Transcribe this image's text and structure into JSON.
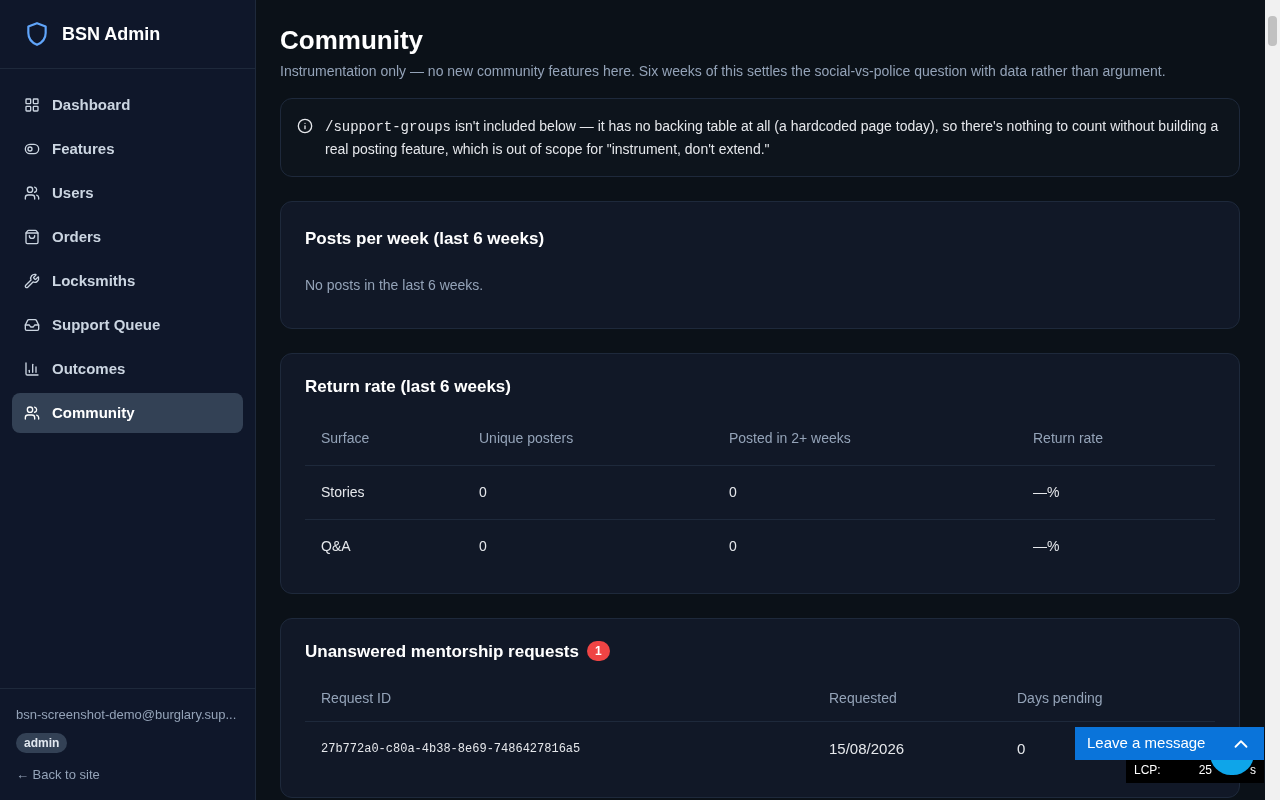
{
  "sidebar": {
    "brand": "BSN Admin",
    "items": [
      {
        "label": "Dashboard",
        "selected": false
      },
      {
        "label": "Features",
        "selected": false
      },
      {
        "label": "Users",
        "selected": false
      },
      {
        "label": "Orders",
        "selected": false
      },
      {
        "label": "Locksmiths",
        "selected": false
      },
      {
        "label": "Support Queue",
        "selected": false
      },
      {
        "label": "Outcomes",
        "selected": false
      },
      {
        "label": "Community",
        "selected": true
      }
    ],
    "email": "bsn-screenshot-demo@burglary.sup...",
    "role": "admin",
    "back_link": "← Back to site"
  },
  "page": {
    "title": "Community",
    "subtitle": "Instrumentation only — no new community features here. Six weeks of this settles the social-vs-police question with data rather than argument.",
    "notice": {
      "code": "/support-groups",
      "text": "isn't included below — it has no backing table at all (a hardcoded page today), so there's nothing to count without building a real posting feature, which is out of scope for \"instrument, don't extend.\""
    },
    "posts_card": {
      "title": "Posts per week (last 6 weeks)",
      "empty": "No posts in the last 6 weeks."
    },
    "return_card": {
      "title": "Return rate (last 6 weeks)",
      "columns": [
        "Surface",
        "Unique posters",
        "Posted in 2+ weeks",
        "Return rate"
      ],
      "rows": [
        [
          "Stories",
          "0",
          "0",
          "—%"
        ],
        [
          "Q&A",
          "0",
          "0",
          "—%"
        ]
      ]
    },
    "mentorship_card": {
      "title": "Unanswered mentorship requests",
      "badge": "1",
      "columns": [
        "Request ID",
        "Requested",
        "Days pending"
      ],
      "rows": [
        [
          "27b772a0-c80a-4b38-8e69-7486427816a5",
          "15/08/2026",
          "0"
        ]
      ]
    }
  },
  "chat_widget": {
    "label": "Leave a message"
  },
  "perf_overlay": {
    "label": "LCP:",
    "value": "25",
    "unit": "s"
  }
}
